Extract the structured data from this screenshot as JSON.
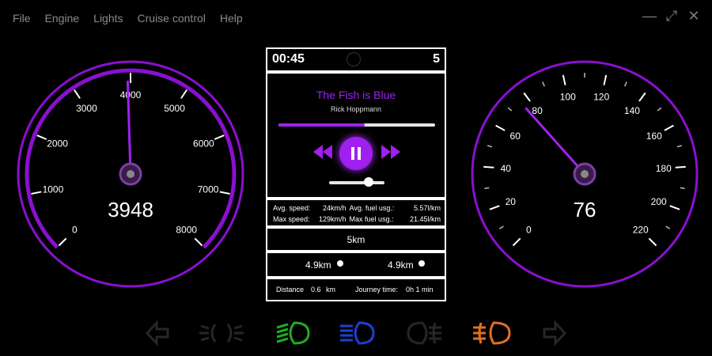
{
  "menu": [
    "File",
    "Engine",
    "Lights",
    "Cruise control",
    "Help"
  ],
  "window_controls": {
    "minimize": "—",
    "maximize": "⤢",
    "close": "✕"
  },
  "rpm_gauge": {
    "ticks": [
      "0",
      "1000",
      "2000",
      "3000",
      "4000",
      "5000",
      "6000",
      "7000",
      "8000"
    ],
    "min": 0,
    "max": 8000,
    "value": 3948,
    "readout": "3948"
  },
  "speed_gauge": {
    "ticks": [
      "0",
      "20",
      "40",
      "60",
      "80",
      "100",
      "120",
      "140",
      "160",
      "180",
      "200",
      "220"
    ],
    "min": 0,
    "max": 220,
    "value": 76,
    "readout": "76"
  },
  "trip": {
    "time": "00:45",
    "gear": "5"
  },
  "music": {
    "title": "The Fish is Blue",
    "artist": "Rick Hoppmann",
    "progress": 0.55,
    "volume": 0.72
  },
  "stats": {
    "avg_speed_label": "Avg. speed:",
    "avg_speed_value": "24km/h",
    "avg_fuel_label": "Avg. fuel usg.:",
    "avg_fuel_value": "5.57l/km",
    "max_speed_label": "Max speed:",
    "max_speed_value": "129km/h",
    "max_fuel_label": "Max fuel usg.:",
    "max_fuel_value": "21.45l/km"
  },
  "distance_5": "5km",
  "distance_left": "4.9km",
  "distance_right": "4.9km",
  "journey": {
    "distance_label": "Distance",
    "distance_value": "0.6",
    "distance_unit": "km",
    "time_label": "Journey time:",
    "time_value": "0h 1 min"
  },
  "colors": {
    "accent": "#a020f0",
    "ring": "#8a10d0",
    "low_beam": "#22aa22",
    "high_beam": "#1e40d0",
    "fog": "#e07020"
  },
  "indicators": [
    {
      "name": "left-turn-signal-icon",
      "active": false
    },
    {
      "name": "parking-lights-icon",
      "active": false
    },
    {
      "name": "low-beam-icon",
      "active": true
    },
    {
      "name": "high-beam-icon",
      "active": true
    },
    {
      "name": "rear-fog-icon",
      "active": false
    },
    {
      "name": "front-fog-icon",
      "active": true
    },
    {
      "name": "right-turn-signal-icon",
      "active": false
    }
  ]
}
